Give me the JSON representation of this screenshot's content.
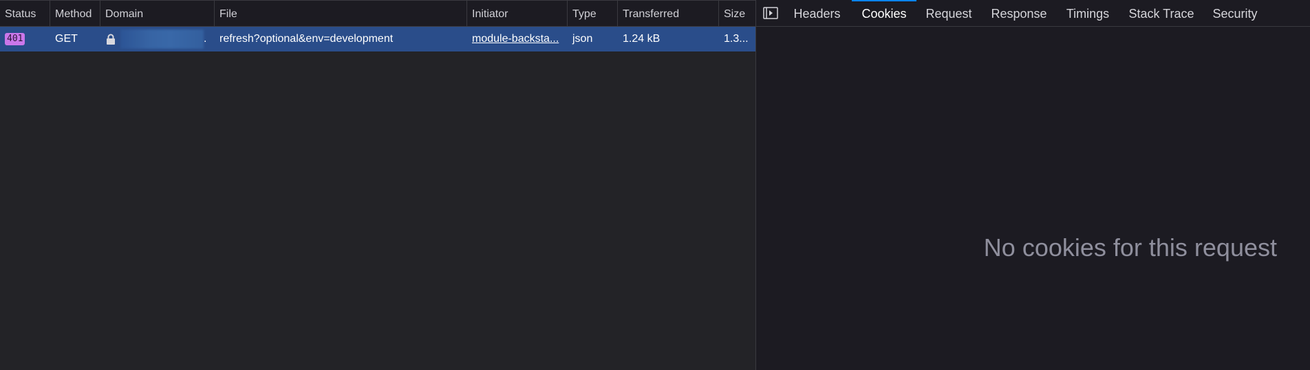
{
  "table": {
    "columns": [
      "Status",
      "Method",
      "Domain",
      "File",
      "Initiator",
      "Type",
      "Transferred",
      "Size"
    ],
    "rows": [
      {
        "status": "401",
        "method": "GET",
        "domain_suffix": ".",
        "file": "refresh?optional&env=development",
        "initiator": "module-backsta...",
        "type": "json",
        "transferred": "1.24 kB",
        "size": "1.3..."
      }
    ]
  },
  "details": {
    "tabs": [
      "Headers",
      "Cookies",
      "Request",
      "Response",
      "Timings",
      "Stack Trace",
      "Security"
    ],
    "active_tab": "Cookies",
    "empty_message": "No cookies for this request"
  },
  "colors": {
    "selected_row": "#2a4d8a",
    "status_badge": "#cb77ea",
    "active_tab_indicator": "#0a84ff"
  },
  "icons": {
    "domain_secure": "lock-icon",
    "panel_toggle": "toggle-sidebar-icon"
  }
}
